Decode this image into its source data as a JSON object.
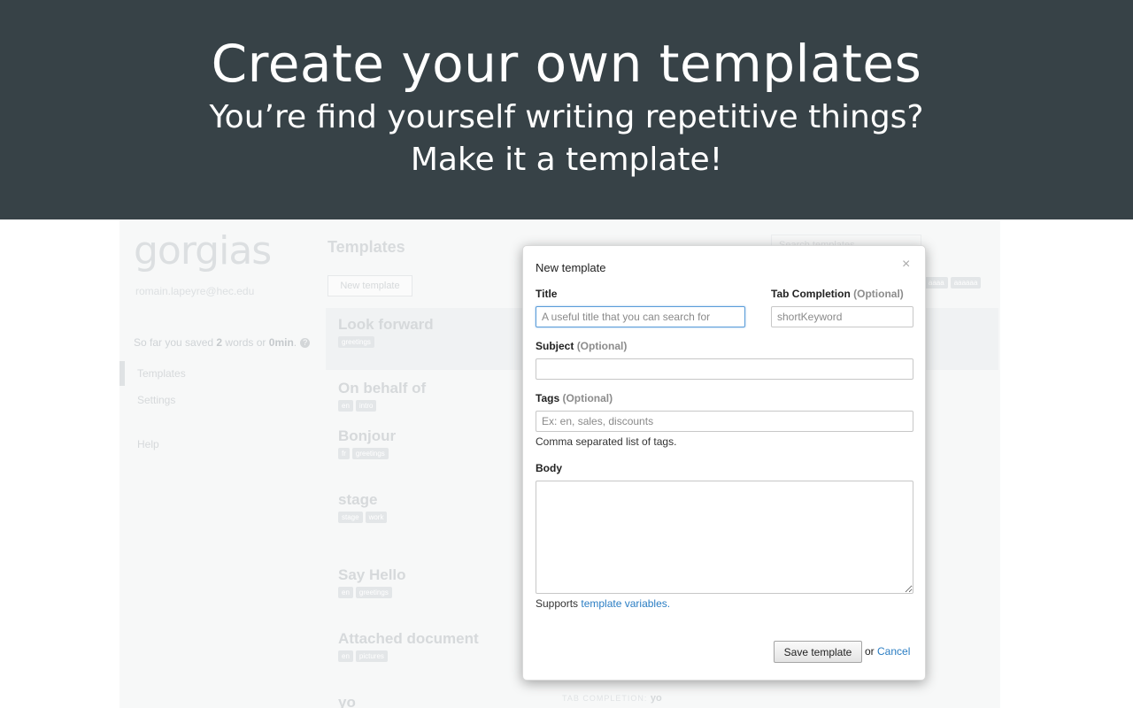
{
  "banner": {
    "headline": "Create your own templates",
    "line1": "You’re find yourself writing repetitive things?",
    "line2": "Make it a template!",
    "background": "#374247"
  },
  "app": {
    "logo": "gorgias",
    "user_email": "romain.lapeyre@hec.edu",
    "saved": {
      "prefix": "So far you saved ",
      "words": "2",
      "middle": " words or ",
      "minutes": "0min",
      "suffix": "."
    },
    "nav": {
      "templates": "Templates",
      "settings": "Settings",
      "help": "Help"
    },
    "page_title": "Templates",
    "new_template_button": "New template",
    "search_placeholder": "Search templates",
    "filter_tags": [
      "aa",
      "aaaa",
      "aaaaaa"
    ],
    "templates": [
      {
        "name": "Look forward",
        "tags": [
          "greetings"
        ]
      },
      {
        "name": "On behalf of",
        "tags": [
          "en",
          "intro"
        ]
      },
      {
        "name": "Bonjour",
        "tags": [
          "fr",
          "greetings"
        ]
      },
      {
        "name": "stage",
        "tags": [
          "stage",
          "work"
        ]
      },
      {
        "name": "Say Hello",
        "tags": [
          "en",
          "greetings"
        ]
      },
      {
        "name": "Attached document",
        "tags": [
          "en",
          "pictures"
        ]
      },
      {
        "name": "yo",
        "tags": []
      }
    ],
    "tab_completion_label": "TAB COMPLETION:",
    "tab_completion_value": "yo"
  },
  "modal": {
    "title": "New template",
    "close_glyph": "×",
    "title_label": "Title",
    "title_placeholder": "A useful title that you can search for",
    "tab_label": "Tab Completion",
    "optional": "(Optional)",
    "tab_placeholder": "shortKeyword",
    "subject_label": "Subject",
    "tags_label": "Tags",
    "tags_placeholder": "Ex: en, sales, discounts",
    "tags_help": "Comma separated list of tags.",
    "body_label": "Body",
    "supports_text": "Supports ",
    "template_variables_link": "template variables.",
    "save_button": "Save template",
    "or_text": "or",
    "cancel_link": "Cancel",
    "accent_color": "#2a7dc3"
  }
}
